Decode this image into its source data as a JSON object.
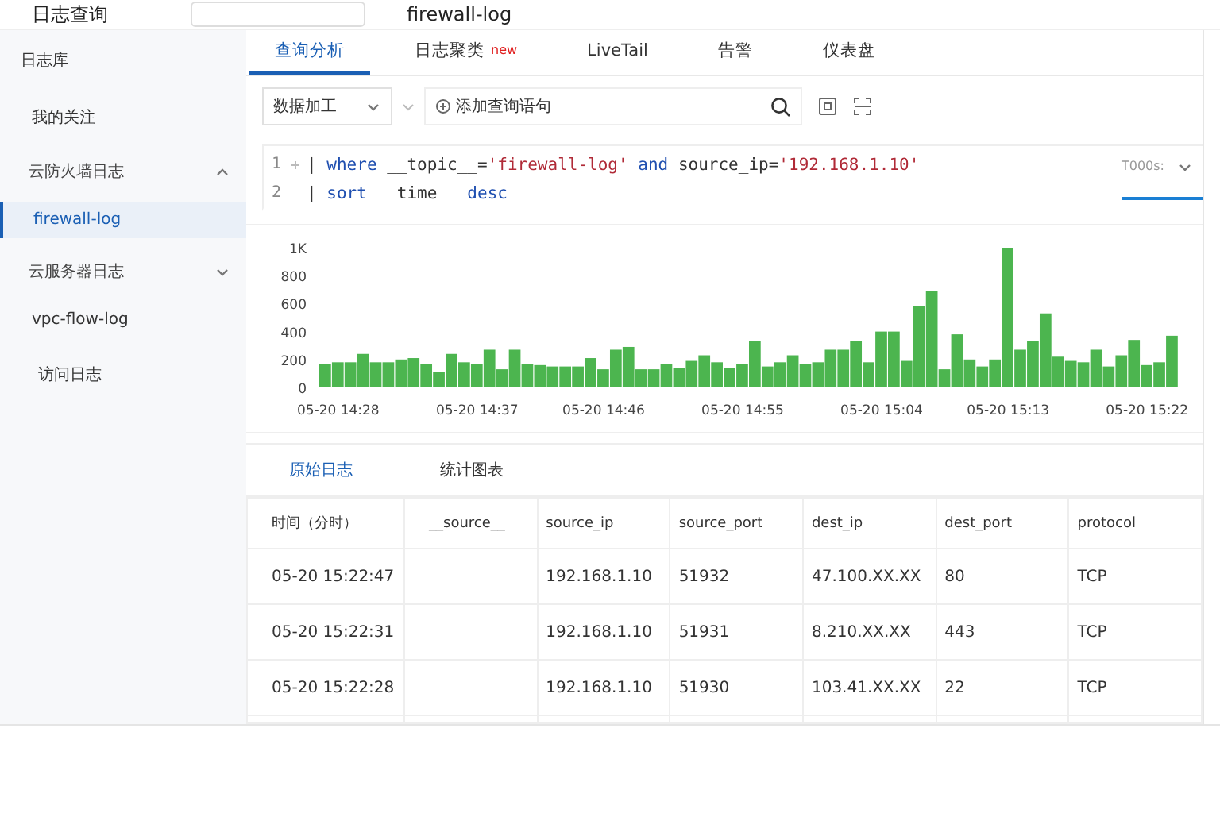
{
  "header": {
    "title": "日志查询",
    "logstore": "firewall-log"
  },
  "sidebar": {
    "heading": "日志库",
    "items": [
      {
        "kind": "link",
        "label": "我的关注",
        "selected": false
      },
      {
        "kind": "group",
        "label": "云防火墙日志",
        "expanded": true,
        "children": [
          {
            "kind": "link",
            "label": "firewall-log",
            "selected": true
          }
        ]
      },
      {
        "kind": "group",
        "label": "云服务器日志",
        "expanded": false
      },
      {
        "kind": "link",
        "label": "vpc-flow-log",
        "selected": false
      },
      {
        "kind": "sublink",
        "label": "访问日志",
        "selected": false
      }
    ]
  },
  "tabs": [
    {
      "label": "查询分析",
      "selected": true
    },
    {
      "label": "日志聚类",
      "badge": "new",
      "selected": false
    },
    {
      "label": "LiveTail",
      "selected": false
    },
    {
      "label": "告警",
      "selected": false
    },
    {
      "label": "仪表盘",
      "selected": false
    }
  ],
  "toolbar": {
    "mode": "数据加工",
    "add_query": "添加查询语句"
  },
  "editor": {
    "lines": [
      {
        "number": "1",
        "tokens": [
          {
            "kind": "plain",
            "text": "| "
          },
          {
            "kind": "keyword",
            "text": "where"
          },
          {
            "kind": "plain",
            "text": " __topic__="
          },
          {
            "kind": "string",
            "text": "'firewall-log'"
          },
          {
            "kind": "keyword",
            "text": " and"
          },
          {
            "kind": "plain",
            "text": " source_ip="
          },
          {
            "kind": "string",
            "text": "'192.168.1.10'"
          }
        ]
      },
      {
        "number": "2",
        "tokens": [
          {
            "kind": "plain",
            "text": "| "
          },
          {
            "kind": "keyword",
            "text": "sort"
          },
          {
            "kind": "plain",
            "text": " __time__ "
          },
          {
            "kind": "keyword",
            "text": "desc"
          }
        ]
      }
    ],
    "hint": "T000s:"
  },
  "chart_data": {
    "type": "bar",
    "categories": [
      null,
      "05-20 14:28",
      null,
      null,
      null,
      null,
      null,
      null,
      null,
      null,
      null,
      null,
      "05-20 14:37",
      null,
      null,
      null,
      null,
      null,
      null,
      null,
      null,
      null,
      "05-20 14:46",
      null,
      null,
      null,
      null,
      null,
      null,
      null,
      null,
      null,
      null,
      "05-20 14:55",
      null,
      null,
      null,
      null,
      null,
      null,
      null,
      null,
      null,
      null,
      "05-20 15:04",
      null,
      null,
      null,
      null,
      null,
      null,
      null,
      null,
      null,
      "05-20 15:13",
      null,
      null,
      null,
      null,
      null,
      null,
      null,
      null,
      null,
      null,
      "05-20 15:22",
      null,
      null
    ],
    "series": [
      {
        "color": "#4cb54f",
        "values": [
          170,
          180,
          180,
          240,
          180,
          180,
          200,
          210,
          170,
          110,
          240,
          180,
          170,
          270,
          130,
          270,
          170,
          160,
          150,
          150,
          150,
          210,
          130,
          270,
          290,
          130,
          130,
          170,
          140,
          190,
          230,
          180,
          140,
          170,
          330,
          150,
          180,
          230,
          170,
          180,
          270,
          270,
          330,
          180,
          400,
          400,
          190,
          580,
          690,
          130,
          380,
          200,
          150,
          200,
          1000,
          270,
          330,
          530,
          220,
          190,
          180,
          270,
          150,
          230,
          340,
          160,
          180,
          370
        ]
      }
    ],
    "ylim": [
      0,
      1000
    ],
    "yticks": [
      0,
      200,
      400,
      600,
      800,
      {
        "value": 1000,
        "label": "1K"
      }
    ]
  },
  "result_tabs": [
    {
      "label": "原始日志",
      "selected": true
    },
    {
      "label": "统计图表",
      "selected": false
    }
  ],
  "table": {
    "columns": [
      "时间（分时）",
      "__source__",
      "source_ip",
      "source_port",
      "dest_ip",
      "dest_port",
      "protocol"
    ],
    "rows": [
      [
        "05-20 15:22:47",
        "",
        "192.168.1.10",
        "51932",
        "47.100.XX.XX",
        "80",
        "TCP"
      ],
      [
        "05-20 15:22:31",
        "",
        "192.168.1.10",
        "51931",
        "8.210.XX.XX",
        "443",
        "TCP"
      ],
      [
        "05-20 15:22:28",
        "",
        "192.168.1.10",
        "51930",
        "103.41.XX.XX",
        "22",
        "TCP"
      ]
    ]
  }
}
